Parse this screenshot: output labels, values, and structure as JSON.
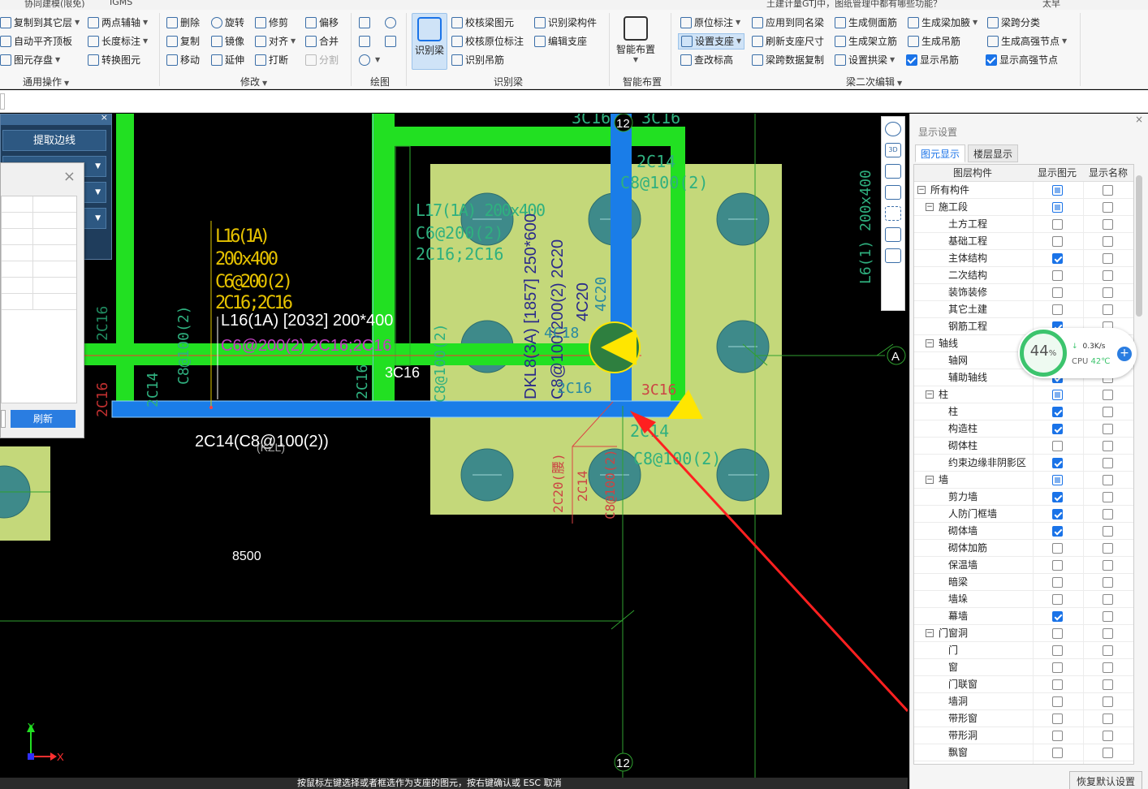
{
  "topbar": {
    "tab_coop": "协同建模(限免)",
    "tab_igms": "IGMS",
    "search_text": "土建计量GTJ中，图纸管理中都有哪些功能？",
    "user": "太早"
  },
  "ribbon": {
    "general": {
      "copy_floor": "复制到其它层",
      "auto_flat": "自动平齐顶板",
      "save_elem": "图元存盘",
      "two_point": "两点辅轴",
      "length_dim": "长度标注",
      "convert": "转换图元",
      "group_label": "通用操作"
    },
    "modify": {
      "delete": "删除",
      "rotate": "旋转",
      "trim": "修剪",
      "offset": "偏移",
      "copy": "复制",
      "mirror": "镜像",
      "align": "对齐",
      "merge": "合并",
      "move": "移动",
      "extend": "延伸",
      "break": "打断",
      "split": "分割",
      "group_label": "修改"
    },
    "draw": {
      "group_label": "绘图"
    },
    "identify": {
      "big": "识别梁",
      "check_beam": "校核梁图元",
      "check_orig": "校核原位标注",
      "identify_hanger": "识别吊筋",
      "identify_member": "识别梁构件",
      "edit_support": "编辑支座",
      "group_label": "识别梁"
    },
    "smart": {
      "big": "智能布置",
      "group_label": "智能布置"
    },
    "secondary": {
      "orig_label": "原位标注",
      "set_support": "设置支座",
      "check_elev": "查改标高",
      "apply_same": "应用到同名梁",
      "refresh_support": "刷新支座尺寸",
      "span_copy": "梁跨数据复制",
      "side_bars": "生成侧面筋",
      "erect_bars": "生成架立筋",
      "set_arch": "设置拱梁",
      "haunch": "生成梁加腋",
      "hanger": "生成吊筋",
      "show_hanger": "显示吊筋",
      "span_class": "梁跨分类",
      "high_node": "生成高强节点",
      "show_high_node": "显示高强节点",
      "group_label": "梁二次编辑"
    }
  },
  "left_panel": {
    "button": "提取边线"
  },
  "dialog": {
    "refresh": "刷新"
  },
  "vtool": {
    "3d": "3D"
  },
  "canvas": {
    "labels": {
      "l16_yellow_1": "L16(1A)",
      "l16_yellow_2": "200x400",
      "l16_yellow_3": "C6@200(2)",
      "l16_yellow_4": "2C16;2C16",
      "l16_white": "L16(1A) [2032] 200*400",
      "l16_magenta": "C6@200(2) 2C16;2C16",
      "c16_white": "3C16",
      "bottom_white": "2C14(C8@100(2))",
      "l17_1": "L17(1A) 200x400",
      "l17_2": "C6@200(2)",
      "l17_3": "2C16;2C16",
      "dkl_1": "DKL8(3A) [1857] 250*600",
      "dkl_2": "C8@100(200(2) 2C20",
      "dkl_3": "4C20",
      "top_left": "3C16",
      "top_right": "3C16",
      "c14_top": "2C14",
      "c8_top": "C8@100(2)",
      "c14_bot": "2C14",
      "c8_bot": "C8@100(2)",
      "c16_red": "3C16",
      "l6": "L6(1) 200x400",
      "left_2c16": "2C16",
      "left_2c16b": "2C16",
      "left_2c14": "2C14",
      "left_c8": "C8@100(2)",
      "mid_2c16": "2C16",
      "mid_c8": "C8@100(2)",
      "mid_4c20": "4C20",
      "mid_4c18": "4C18",
      "mid_2c16b": "2C16",
      "dim_8500": "8500",
      "axis_12_top": "12",
      "axis_12_bot": "12",
      "axis_a": "A",
      "axis_y": "Y",
      "axis_x": "X",
      "red_small_1": "2C20(腰)",
      "red_small_2": "2C14",
      "red_small_3": "C8@100(2)",
      "gray_label": "(KZL)"
    }
  },
  "display_panel": {
    "title": "显示设置",
    "tabs": [
      "图元显示",
      "楼层显示"
    ],
    "col_layer": "图层构件",
    "col_show": "显示图元",
    "col_name": "显示名称",
    "rows": [
      {
        "name": "所有构件",
        "level": 0,
        "toggle": "−",
        "show": "part",
        "label": false
      },
      {
        "name": "施工段",
        "level": 1,
        "toggle": "−",
        "show": "part",
        "label": false
      },
      {
        "name": "土方工程",
        "level": 2,
        "show": false,
        "label": false
      },
      {
        "name": "基础工程",
        "level": 2,
        "show": false,
        "label": false
      },
      {
        "name": "主体结构",
        "level": 2,
        "show": true,
        "label": false
      },
      {
        "name": "二次结构",
        "level": 2,
        "show": false,
        "label": false
      },
      {
        "name": "装饰装修",
        "level": 2,
        "show": false,
        "label": false
      },
      {
        "name": "其它土建",
        "level": 2,
        "show": false,
        "label": false
      },
      {
        "name": "钢筋工程",
        "level": 2,
        "show": true,
        "label": false
      },
      {
        "name": "轴线",
        "level": 1,
        "toggle": "−",
        "show": "part",
        "label": false
      },
      {
        "name": "轴网",
        "level": 2,
        "show": true,
        "label": false
      },
      {
        "name": "辅助轴线",
        "level": 2,
        "show": true,
        "label": false
      },
      {
        "name": "柱",
        "level": 1,
        "toggle": "−",
        "show": "part",
        "label": false
      },
      {
        "name": "柱",
        "level": 2,
        "show": true,
        "label": false
      },
      {
        "name": "构造柱",
        "level": 2,
        "show": true,
        "label": false
      },
      {
        "name": "砌体柱",
        "level": 2,
        "show": false,
        "label": false
      },
      {
        "name": "约束边缘非阴影区",
        "level": 2,
        "show": true,
        "label": false
      },
      {
        "name": "墙",
        "level": 1,
        "toggle": "−",
        "show": "part",
        "label": false
      },
      {
        "name": "剪力墙",
        "level": 2,
        "show": true,
        "label": false
      },
      {
        "name": "人防门框墙",
        "level": 2,
        "show": true,
        "label": false
      },
      {
        "name": "砌体墙",
        "level": 2,
        "show": true,
        "label": false
      },
      {
        "name": "砌体加筋",
        "level": 2,
        "show": false,
        "label": false
      },
      {
        "name": "保温墙",
        "level": 2,
        "show": false,
        "label": false
      },
      {
        "name": "暗梁",
        "level": 2,
        "show": false,
        "label": false
      },
      {
        "name": "墙垛",
        "level": 2,
        "show": false,
        "label": false
      },
      {
        "name": "幕墙",
        "level": 2,
        "show": true,
        "label": false
      },
      {
        "name": "门窗洞",
        "level": 1,
        "toggle": "−",
        "show": false,
        "label": false
      },
      {
        "name": "门",
        "level": 2,
        "show": false,
        "label": false
      },
      {
        "name": "窗",
        "level": 2,
        "show": false,
        "label": false
      },
      {
        "name": "门联窗",
        "level": 2,
        "show": false,
        "label": false
      },
      {
        "name": "墙洞",
        "level": 2,
        "show": false,
        "label": false
      },
      {
        "name": "带形窗",
        "level": 2,
        "show": false,
        "label": false
      },
      {
        "name": "带形洞",
        "level": 2,
        "show": false,
        "label": false
      },
      {
        "name": "飘窗",
        "level": 2,
        "show": false,
        "label": false
      }
    ],
    "restore": "恢复默认设置"
  },
  "cpu_widget": {
    "percent": "44",
    "pct_sign": "%",
    "speed": "0.3K/s",
    "cpu_label": "CPU",
    "temp": "42℃",
    "plus": "+"
  },
  "status": {
    "text": "按鼠标左键选择或者框选作为支座的图元，按右键确认或 ESC 取消"
  },
  "colors": {
    "beam_green": "#22e022",
    "beam_blue": "#1a7de8",
    "slab_fill": "#c4d87a",
    "pile_fill": "#3e8a8a",
    "arrow_red": "#ff2020"
  }
}
